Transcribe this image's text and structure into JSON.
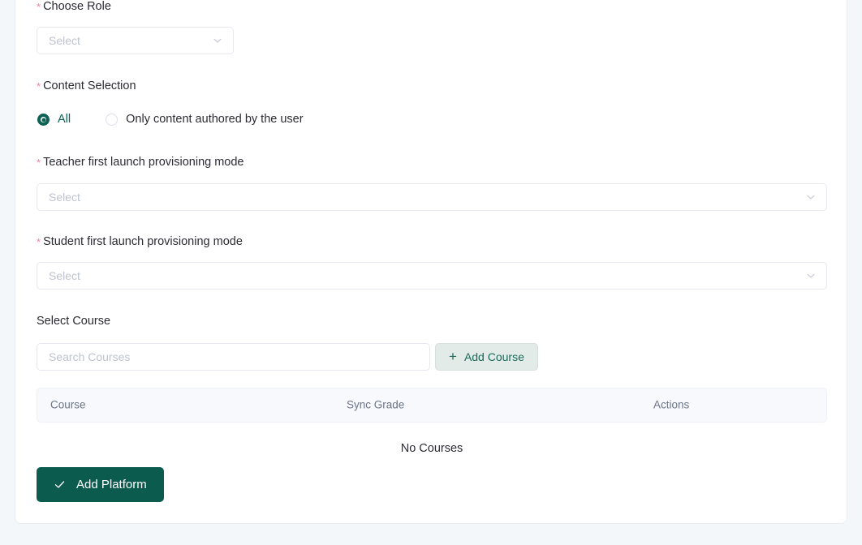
{
  "form": {
    "choose_role": {
      "label": "Choose Role",
      "required_marker": "*",
      "select_placeholder": "Select",
      "chevron_icon": "chevron-down-icon"
    },
    "content_selection": {
      "label": "Content Selection",
      "required_marker": "*",
      "options": [
        {
          "label": "All",
          "selected": true
        },
        {
          "label": "Only content authored by the user",
          "selected": false
        }
      ]
    },
    "teacher_provisioning": {
      "label": "Teacher first launch provisioning mode",
      "required_marker": "*",
      "select_placeholder": "Select",
      "chevron_icon": "chevron-down-icon"
    },
    "student_provisioning": {
      "label": "Student first launch provisioning mode",
      "required_marker": "*",
      "select_placeholder": "Select",
      "chevron_icon": "chevron-down-icon"
    },
    "select_course": {
      "label": "Select Course",
      "search_placeholder": "Search Courses",
      "search_value": "",
      "add_course_button": {
        "label": "Add Course",
        "icon": "plus-icon"
      }
    },
    "courses_table": {
      "columns": [
        "Course",
        "Sync Grade",
        "Actions"
      ],
      "rows": [],
      "empty_text": "No Courses"
    },
    "submit_button": {
      "label": "Add Platform",
      "icon": "check-icon"
    }
  },
  "colors": {
    "primary": "#0b5c4f",
    "primary_text": "#1d6a5c",
    "accent_soft_bg": "#e2ebe7",
    "required_star": "#f08098",
    "page_bg": "#f4f7fa",
    "table_header_bg": "#f7f9fc",
    "muted_text": "#6b7687",
    "placeholder": "#bfc3cf"
  }
}
